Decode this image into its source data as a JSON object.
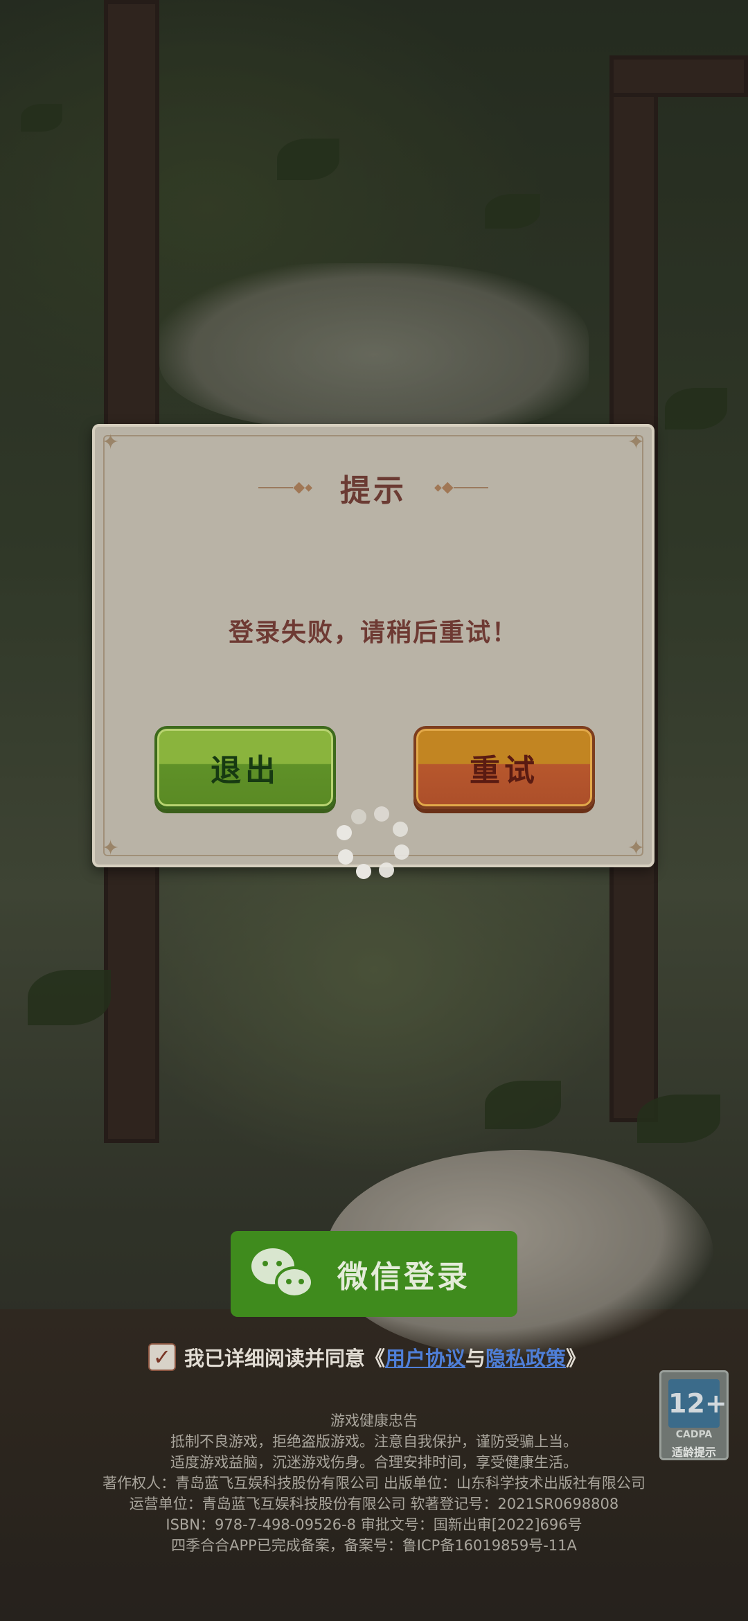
{
  "dialog": {
    "title": "提示",
    "message": "登录失败，请稍后重试！",
    "exit_label": "退出",
    "retry_label": "重试"
  },
  "login": {
    "wechat_label": "微信登录"
  },
  "agreement": {
    "checked": true,
    "prefix": "我已详细阅读并同意《",
    "user_agreement": "用户协议",
    "conjunction": "与",
    "privacy_policy": "隐私政策",
    "suffix": "》"
  },
  "age_rating": {
    "age": "12+",
    "org": "CADPA",
    "tip": "适龄提示"
  },
  "footer": {
    "lines": [
      "游戏健康忠告",
      "抵制不良游戏，拒绝盗版游戏。注意自我保护，谨防受骗上当。",
      "适度游戏益脑，沉迷游戏伤身。合理安排时间，享受健康生活。",
      "著作权人：青岛蓝飞互娱科技股份有限公司 出版单位：山东科学技术出版社有限公司",
      "运营单位：青岛蓝飞互娱科技股份有限公司  软著登记号：2021SR0698808",
      "ISBN：978-7-498-09526-8  审批文号：国新出审[2022]696号",
      "四季合合APP已完成备案，备案号：鲁ICP备16019859号-11A"
    ]
  }
}
